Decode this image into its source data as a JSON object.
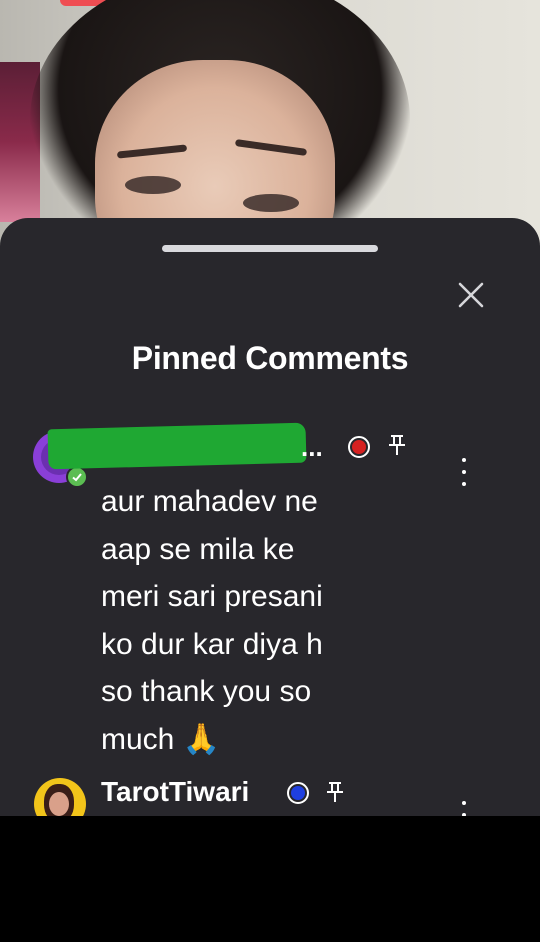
{
  "sheet": {
    "title": "Pinned Comments",
    "close_icon": "close-icon"
  },
  "comments": [
    {
      "author": "",
      "author_truncation": "...",
      "author_redacted": true,
      "status_color": "#d62121",
      "text": "aur mahadev ne\naap se mila ke\nmeri sari presani\nko dur kar diya h\nso thank you so\nmuch 🙏",
      "pinned": true
    },
    {
      "author": "TarotTiwari",
      "status_color": "#1f3fe0",
      "pinned": true
    }
  ]
}
